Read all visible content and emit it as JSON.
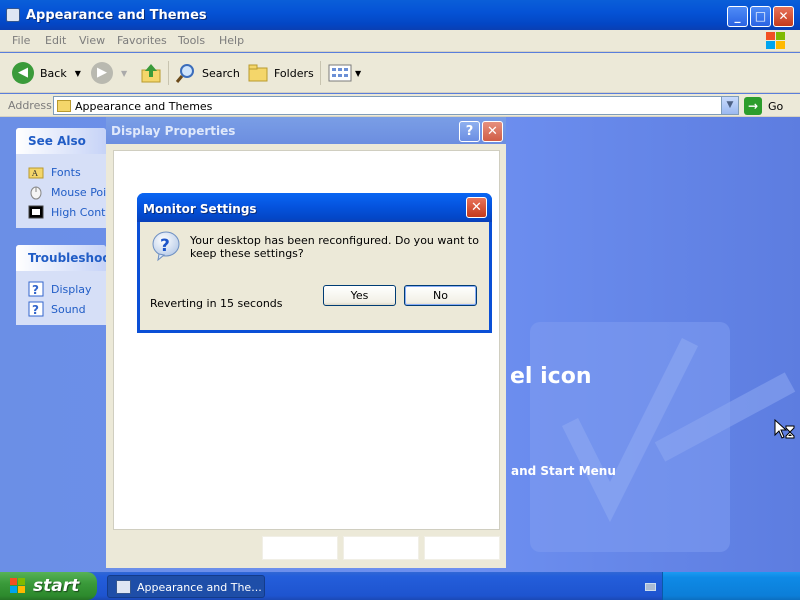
{
  "main_window": {
    "title": "Appearance and Themes",
    "menu": [
      "File",
      "Edit",
      "View",
      "Favorites",
      "Tools",
      "Help"
    ],
    "toolbar": {
      "back": "Back",
      "search": "Search",
      "folders": "Folders"
    },
    "address": {
      "label": "Address",
      "value": "Appearance and Themes",
      "go": "Go"
    }
  },
  "sidebar": {
    "see_also": {
      "heading": "See Also",
      "items": [
        "Fonts",
        "Mouse Poin",
        "High Contr"
      ]
    },
    "troubleshooters": {
      "heading": "Troubleshoot",
      "items": [
        "Display",
        "Sound"
      ]
    }
  },
  "content": {
    "big_text": "el icon",
    "link_text": "and Start Menu"
  },
  "display_properties": {
    "title": "Display Properties",
    "help": "?",
    "close": "✕"
  },
  "monitor_settings": {
    "title": "Monitor Settings",
    "message": "Your desktop has been reconfigured.  Do you want to keep these settings?",
    "countdown": "Reverting in 15 seconds",
    "yes": "Yes",
    "no": "No",
    "close": "✕"
  },
  "taskbar": {
    "start": "start",
    "task_button": "Appearance and The..."
  },
  "colors": {
    "title_blue": "#0553d6",
    "dialog_bg": "#ece9d8",
    "start_green": "#3a9a3a",
    "content_blue": "#6d8ff0"
  },
  "icons": {
    "question": "question-icon",
    "hourglass_cursor": "arrow-hourglass-cursor-icon"
  }
}
